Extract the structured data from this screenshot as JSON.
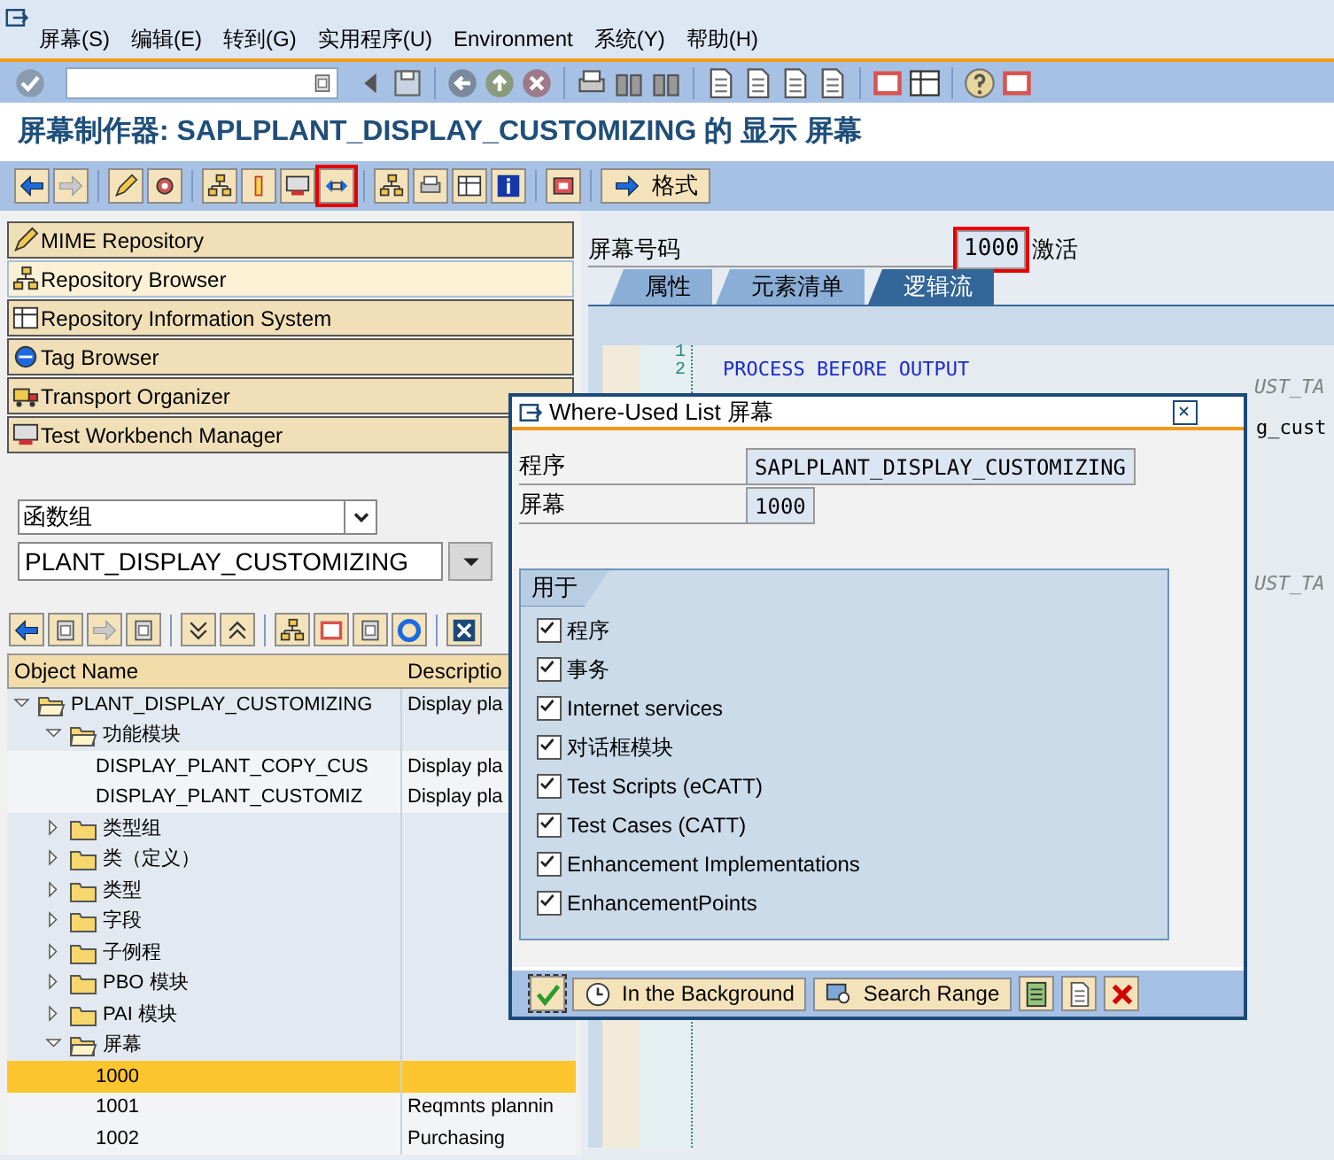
{
  "menu": [
    {
      "label": "屏幕(S)"
    },
    {
      "label": "编辑(E)"
    },
    {
      "label": "转到(G)"
    },
    {
      "label": "实用程序(U)"
    },
    {
      "label": "Environment"
    },
    {
      "label": "系统(Y)"
    },
    {
      "label": "帮助(H)"
    }
  ],
  "title": "屏幕制作器: SAPLPLANT_DISPLAY_CUSTOMIZING 的 显示 屏幕",
  "app_toolbar": [
    {
      "kind": "icon",
      "highlighted": false
    },
    {
      "kind": "icon",
      "highlighted": false
    },
    {
      "kind": "separator"
    },
    {
      "kind": "icon",
      "highlighted": false
    },
    {
      "kind": "icon",
      "highlighted": false
    },
    {
      "kind": "separator"
    },
    {
      "kind": "icon",
      "highlighted": false
    },
    {
      "kind": "icon",
      "highlighted": false
    },
    {
      "kind": "icon",
      "highlighted": false
    },
    {
      "kind": "icon",
      "highlighted": true
    },
    {
      "kind": "separator"
    },
    {
      "kind": "icon",
      "highlighted": false
    },
    {
      "kind": "icon",
      "highlighted": false
    },
    {
      "kind": "icon",
      "highlighted": false
    },
    {
      "kind": "icon",
      "highlighted": false
    },
    {
      "kind": "separator"
    },
    {
      "kind": "icon",
      "highlighted": false
    },
    {
      "kind": "separator"
    },
    {
      "kind": "button",
      "label": "格式",
      "highlighted": false
    }
  ],
  "workbench_nav": [
    {
      "label": "MIME Repository",
      "selected": false
    },
    {
      "label": "Repository Browser",
      "selected": true
    },
    {
      "label": "Repository Information System",
      "selected": false
    },
    {
      "label": "Tag Browser",
      "selected": false
    },
    {
      "label": "Transport Organizer",
      "selected": false
    },
    {
      "label": "Test Workbench Manager",
      "selected": false
    }
  ],
  "object_type": {
    "value": "函数组"
  },
  "object_name": {
    "value": "PLANT_DISPLAY_CUSTOMIZING"
  },
  "tree": {
    "columns": [
      "Object Name",
      "Descriptio"
    ],
    "nodes": [
      {
        "name": "PLANT_DISPLAY_CUSTOMIZING",
        "description": "Display pla",
        "kind": "folder",
        "expanded": true,
        "selected": false,
        "children": [
          {
            "name": "功能模块",
            "kind": "folder",
            "expanded": true,
            "selected": false,
            "children": [
              {
                "name": "DISPLAY_PLANT_COPY_CUS",
                "description": "Display pla",
                "kind": "leaf",
                "selected": false
              },
              {
                "name": "DISPLAY_PLANT_CUSTOMIZ",
                "description": "Display pla",
                "kind": "leaf",
                "selected": false
              }
            ]
          },
          {
            "name": "类型组",
            "kind": "folder",
            "expanded": false,
            "selected": false
          },
          {
            "name": "类（定义）",
            "kind": "folder",
            "expanded": false,
            "selected": false
          },
          {
            "name": "类型",
            "kind": "folder",
            "expanded": false,
            "selected": false
          },
          {
            "name": "字段",
            "kind": "folder",
            "expanded": false,
            "selected": false
          },
          {
            "name": "子例程",
            "kind": "folder",
            "expanded": false,
            "selected": false
          },
          {
            "name": "PBO 模块",
            "kind": "folder",
            "expanded": false,
            "selected": false
          },
          {
            "name": "PAI 模块",
            "kind": "folder",
            "expanded": false,
            "selected": false
          },
          {
            "name": "屏幕",
            "kind": "folder",
            "expanded": true,
            "selected": false,
            "children": [
              {
                "name": "1000",
                "kind": "leaf",
                "selected": true
              },
              {
                "name": "1001",
                "description": "Reqmnts plannin",
                "kind": "leaf",
                "selected": false
              },
              {
                "name": "1002",
                "description": "Purchasing",
                "kind": "leaf",
                "selected": false
              }
            ]
          }
        ]
      }
    ]
  },
  "screen_number": {
    "label": "屏幕号码",
    "value": "1000",
    "status": "激活",
    "highlighted": true
  },
  "tabs": [
    {
      "label": "属性",
      "selected": false
    },
    {
      "label": "元素清单",
      "selected": false
    },
    {
      "label": "逻辑流",
      "selected": true
    }
  ],
  "editor": {
    "lines": [
      {
        "number": "1"
      },
      {
        "number": "2",
        "text": "PROCESS BEFORE OUTPUT",
        "kind": "keyword"
      },
      {
        "text": "UST_TA",
        "kind": "comment"
      },
      {
        "text": "g_cust",
        "kind": "code"
      },
      {
        "text": "UST_TA",
        "kind": "comment"
      }
    ]
  },
  "dialog": {
    "title": "Where-Used List 屏幕",
    "fields": [
      {
        "label": "程序",
        "value": "SAPLPLANT_DISPLAY_CUSTOMIZING"
      },
      {
        "label": "屏幕",
        "value": "1000"
      }
    ],
    "group": {
      "title": "用于",
      "options": [
        {
          "label": "程序",
          "checked": true
        },
        {
          "label": "事务",
          "checked": true
        },
        {
          "label": "Internet services",
          "checked": true
        },
        {
          "label": "对话框模块",
          "checked": true
        },
        {
          "label": "Test Scripts (eCATT)",
          "checked": true
        },
        {
          "label": "Test Cases (CATT)",
          "checked": true
        },
        {
          "label": "Enhancement Implementations",
          "checked": true
        },
        {
          "label": "EnhancementPoints",
          "checked": true
        }
      ]
    },
    "buttons": [
      {
        "kind": "confirm"
      },
      {
        "kind": "clock",
        "label": "In the Background"
      },
      {
        "kind": "search",
        "label": "Search Range"
      },
      {
        "kind": "list"
      },
      {
        "kind": "page"
      },
      {
        "kind": "cancel"
      }
    ]
  }
}
